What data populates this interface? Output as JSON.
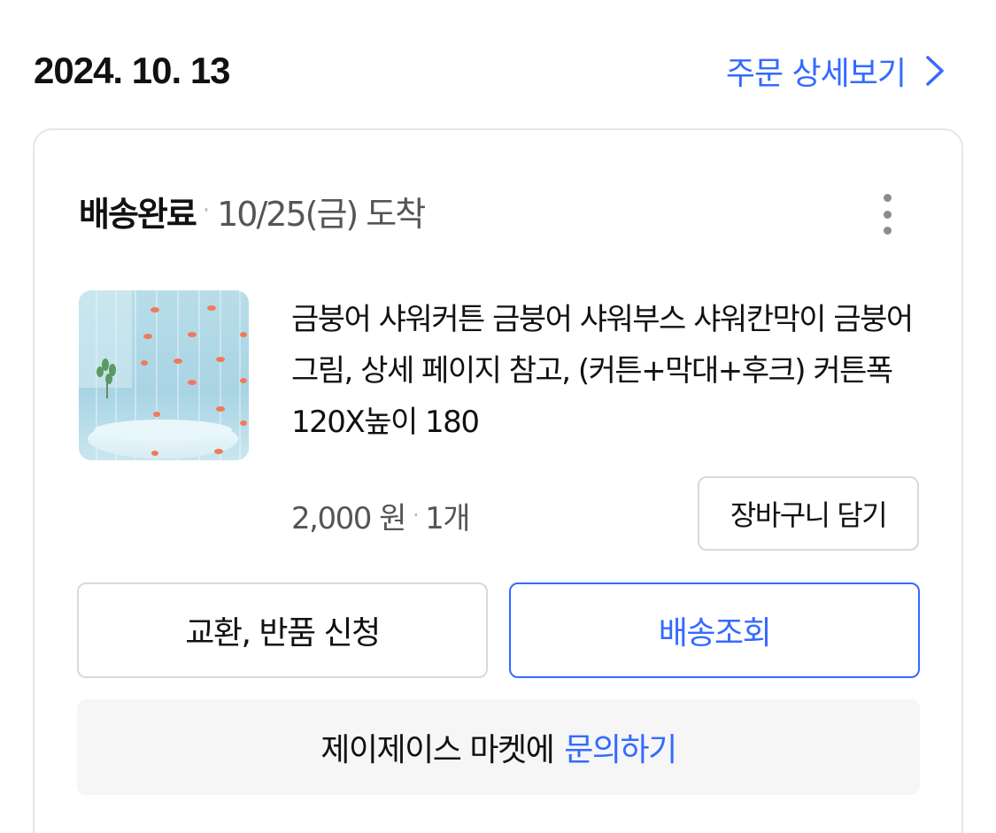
{
  "order": {
    "date": "2024. 10. 13",
    "detail_link": "주문 상세보기"
  },
  "shipment": {
    "status": "배송완료",
    "arrival": "10/25(금) 도착"
  },
  "product": {
    "name": "금붕어 샤워커튼 금붕어 샤워부스 샤워칸막이 금붕어그림, 상세 페이지 참고, (커튼+막대+후크) 커튼폭 120X높이 180",
    "price": "2,000 원",
    "quantity": "1개",
    "cart_button": "장바구니 담기"
  },
  "actions": {
    "exchange_return": "교환, 반품 신청",
    "track_delivery": "배송조회"
  },
  "inquiry": {
    "prefix": "제이제이스 마켓에",
    "link": "문의하기"
  },
  "colors": {
    "accent": "#346aff",
    "text": "#111111",
    "secondary_text": "#555555",
    "border": "#d9d9d9",
    "inquiry_bg": "#f6f6f6"
  },
  "icons": {
    "detail_arrow": "chevron-right-icon",
    "more_menu": "more-vertical-icon"
  }
}
